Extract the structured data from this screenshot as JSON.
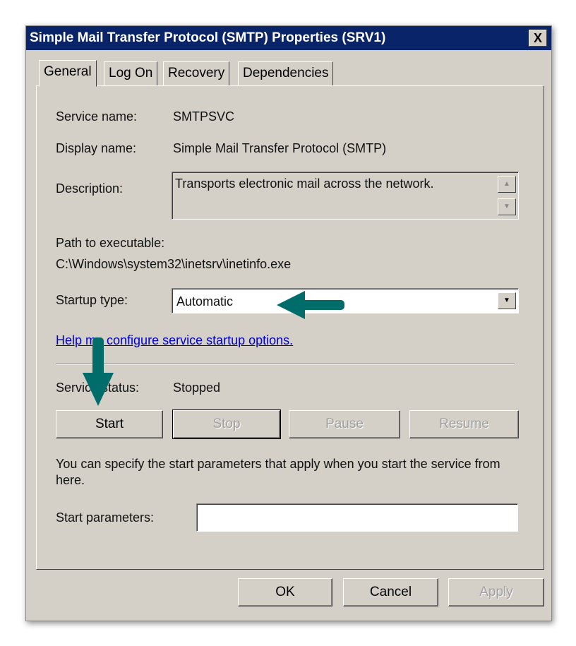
{
  "window": {
    "title": "Simple Mail Transfer Protocol (SMTP) Properties (SRV1)",
    "close": "X"
  },
  "tabs": [
    {
      "label": "General"
    },
    {
      "label": "Log On"
    },
    {
      "label": "Recovery"
    },
    {
      "label": "Dependencies"
    }
  ],
  "general": {
    "service_name_label": "Service name:",
    "service_name": "SMTPSVC",
    "display_name_label": "Display name:",
    "display_name": "Simple Mail Transfer Protocol (SMTP)",
    "description_label": "Description:",
    "description": "Transports electronic mail across the network.",
    "path_label": "Path to executable:",
    "path": "C:\\Windows\\system32\\inetsrv\\inetinfo.exe",
    "startup_label": "Startup type:",
    "startup_value": "Automatic",
    "help_link": "Help me configure service startup options.",
    "status_label": "Service status:",
    "status": "Stopped",
    "buttons": {
      "start": "Start",
      "stop": "Stop",
      "pause": "Pause",
      "resume": "Resume"
    },
    "hint": "You can specify the start parameters that apply when you start the service from here.",
    "params_label": "Start parameters:",
    "params_value": ""
  },
  "footer": {
    "ok": "OK",
    "cancel": "Cancel",
    "apply": "Apply"
  },
  "colors": {
    "titlebar": "#0a246a",
    "annotation_arrow": "#006d6a",
    "link": "#0000cc"
  }
}
